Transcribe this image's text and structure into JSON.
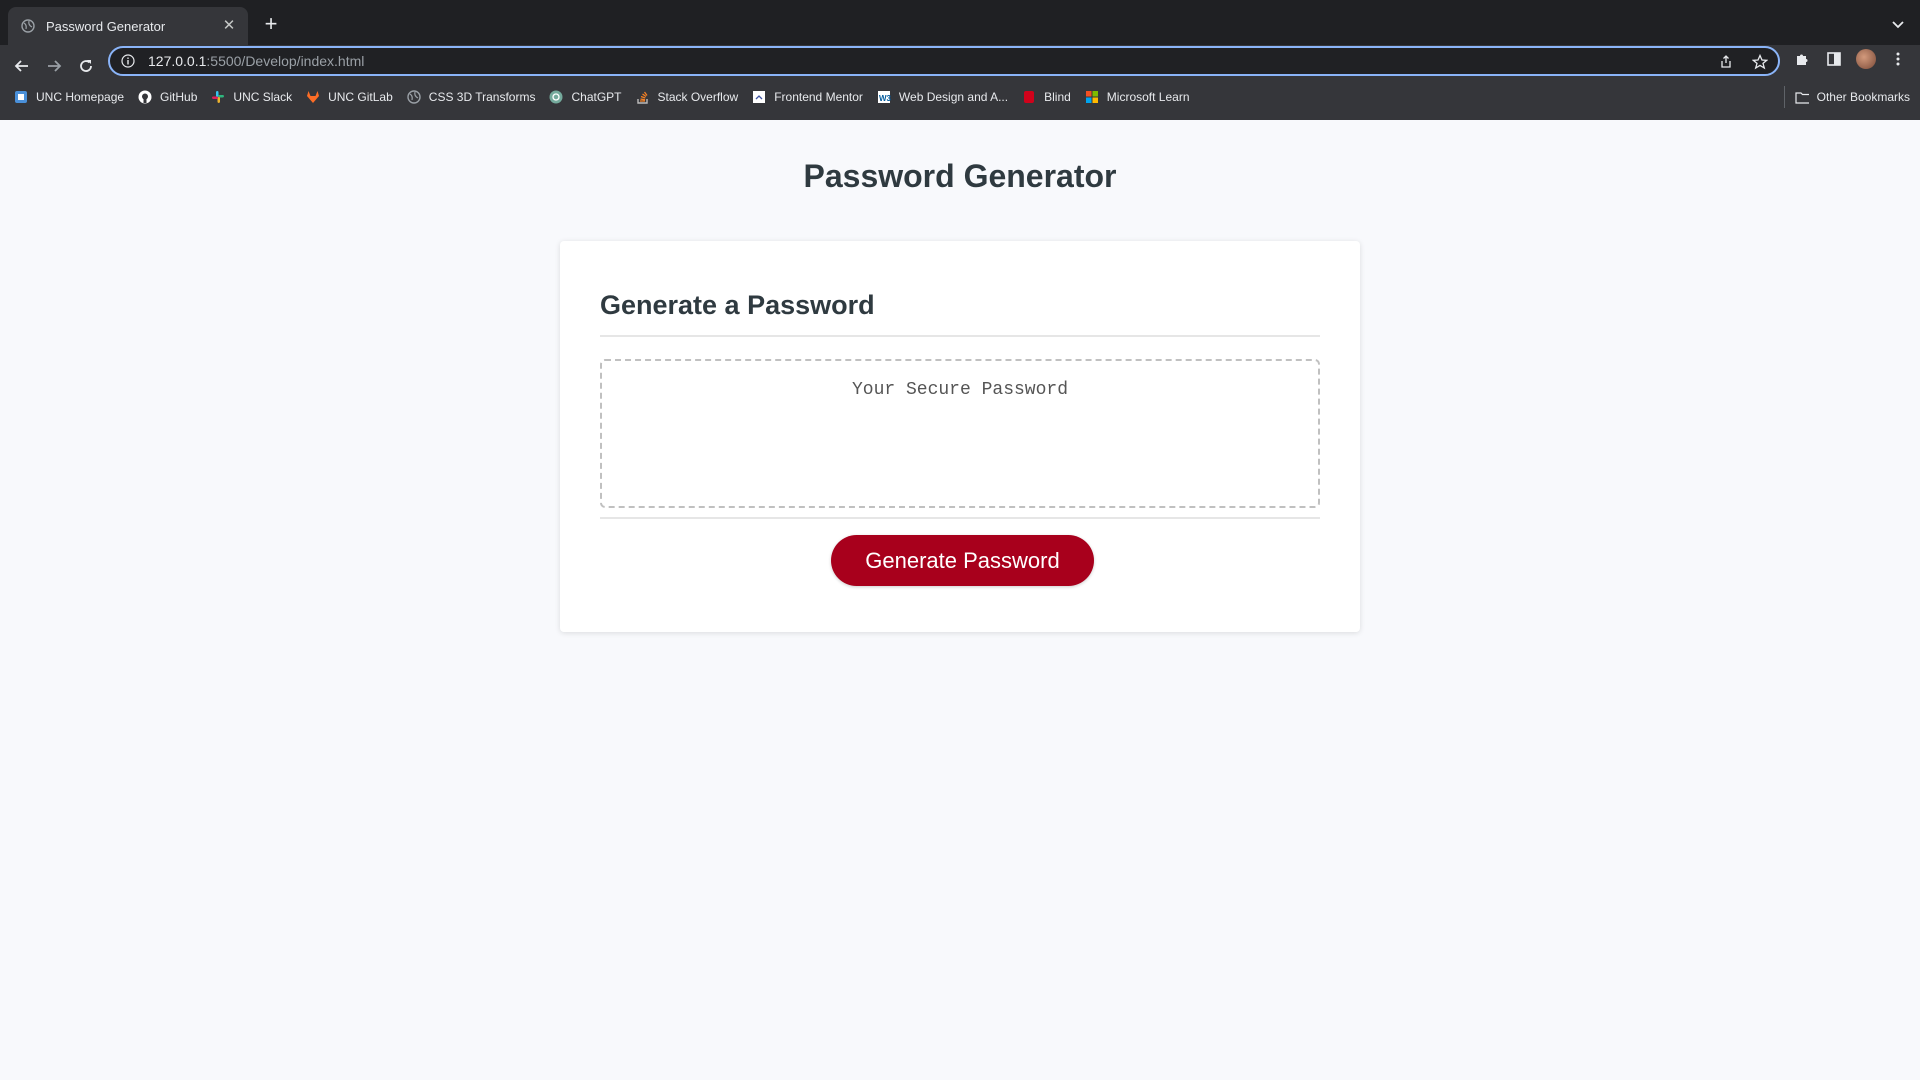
{
  "browser": {
    "tab_title": "Password Generator",
    "url_host": "127.0.0.1",
    "url_rest": ":5500/Develop/index.html",
    "bookmarks": [
      {
        "label": "UNC Homepage",
        "icon": "unc-homepage-icon",
        "color": "#4a90d9"
      },
      {
        "label": "GitHub",
        "icon": "github-icon",
        "color": "#ffffff"
      },
      {
        "label": "UNC Slack",
        "icon": "slack-icon",
        "color": "#e01e5a"
      },
      {
        "label": "UNC GitLab",
        "icon": "gitlab-icon",
        "color": "#fc6d26"
      },
      {
        "label": "CSS 3D Transforms",
        "icon": "globe-icon",
        "color": "#9aa0a6"
      },
      {
        "label": "ChatGPT",
        "icon": "chatgpt-icon",
        "color": "#74aa9c"
      },
      {
        "label": "Stack Overflow",
        "icon": "stackoverflow-icon",
        "color": "#f48024"
      },
      {
        "label": "Frontend Mentor",
        "icon": "frontend-mentor-icon",
        "color": "#ffffff"
      },
      {
        "label": "Web Design and A...",
        "icon": "w3-icon",
        "color": "#ffffff"
      },
      {
        "label": "Blind",
        "icon": "blind-icon",
        "color": "#d0021b"
      },
      {
        "label": "Microsoft Learn",
        "icon": "microsoft-icon",
        "color": "#f25022"
      }
    ],
    "other_bookmarks": "Other Bookmarks"
  },
  "page": {
    "title": "Password Generator",
    "card_title": "Generate a Password",
    "password_placeholder": "Your Secure Password",
    "generate_button": "Generate Password"
  },
  "colors": {
    "button": "#a8001c",
    "heading": "#2f3a40",
    "page_bg": "#f8f9fc"
  }
}
